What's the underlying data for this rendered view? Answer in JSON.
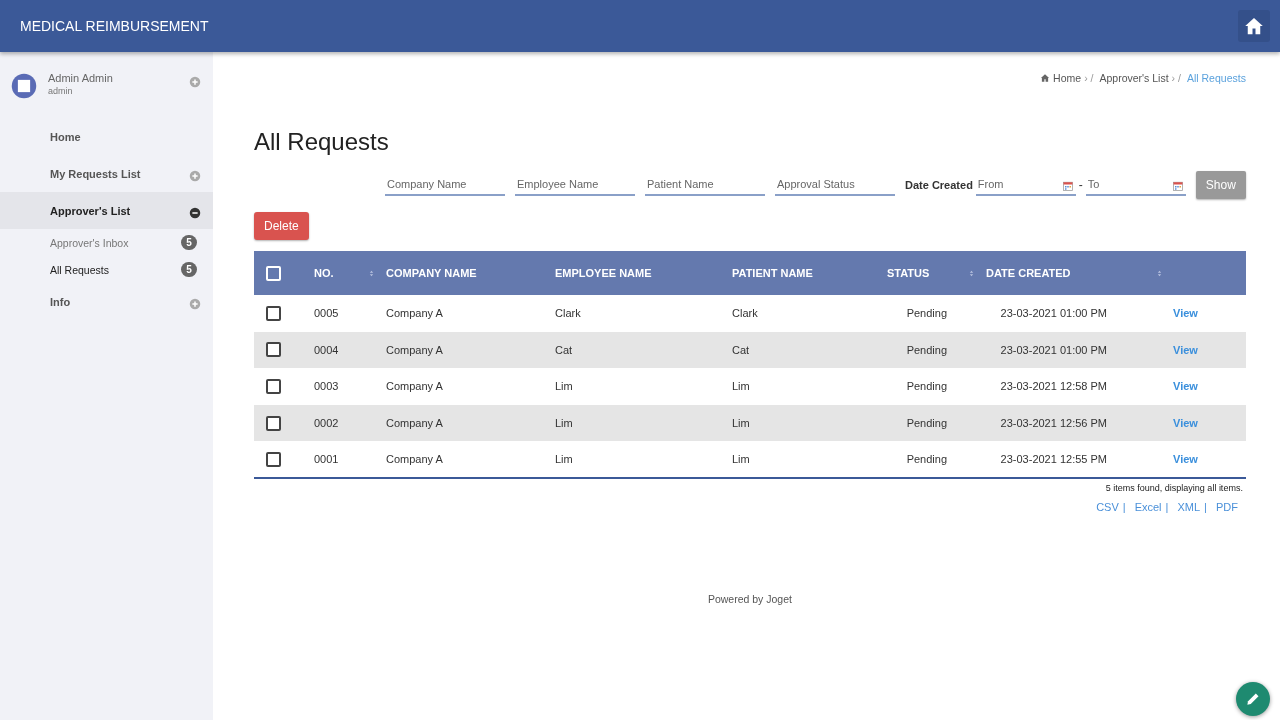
{
  "app_bar": {
    "title": "MEDICAL REIMBURSEMENT"
  },
  "sidebar": {
    "user": {
      "name": "Admin Admin",
      "username": "admin"
    },
    "items": [
      {
        "label": "Home",
        "selected": false
      },
      {
        "label": "My Requests List",
        "selected": false,
        "expanded": false
      },
      {
        "label": "Approver's List",
        "selected": true,
        "expanded": true,
        "children": [
          {
            "label": "Approver's Inbox",
            "count": "5",
            "selected": false
          },
          {
            "label": "All Requests",
            "count": "5",
            "selected": true
          }
        ]
      },
      {
        "label": "Info",
        "selected": false,
        "expanded": false
      }
    ]
  },
  "breadcrumb": [
    {
      "label": "Home",
      "separator": "› /",
      "current": false
    },
    {
      "label": "Approver's List",
      "separator": "› /",
      "current": false
    },
    {
      "label": "All Requests",
      "current": true
    }
  ],
  "page_title": "All Requests",
  "filters": {
    "fields": [
      {
        "placeholder": "Company Name"
      },
      {
        "placeholder": "Employee Name"
      },
      {
        "placeholder": "Patient Name"
      },
      {
        "placeholder": "Approval Status"
      }
    ],
    "date_label": "Date Created",
    "from": {
      "placeholder": "From"
    },
    "dash": "-",
    "to": {
      "placeholder": "To"
    },
    "show_button": "Show"
  },
  "delete_button": "Delete",
  "table": {
    "header_checked": false,
    "columns": [
      {
        "label": "NO.",
        "sortable": true
      },
      {
        "label": "COMPANY NAME",
        "sortable": false
      },
      {
        "label": "EMPLOYEE NAME",
        "sortable": false
      },
      {
        "label": "PATIENT NAME",
        "sortable": false
      },
      {
        "label": "STATUS",
        "sortable": true
      },
      {
        "label": "DATE CREATED",
        "sortable": true
      }
    ],
    "rows": [
      {
        "checked": false,
        "cells": [
          "0005",
          "Company A",
          "Clark",
          "Clark",
          "Pending",
          "23-03-2021 01:00 PM"
        ],
        "action": "View"
      },
      {
        "checked": false,
        "cells": [
          "0004",
          "Company A",
          "Cat",
          "Cat",
          "Pending",
          "23-03-2021 01:00 PM"
        ],
        "action": "View"
      },
      {
        "checked": false,
        "cells": [
          "0003",
          "Company A",
          "Lim",
          "Lim",
          "Pending",
          "23-03-2021 12:58 PM"
        ],
        "action": "View"
      },
      {
        "checked": false,
        "cells": [
          "0002",
          "Company A",
          "Lim",
          "Lim",
          "Pending",
          "23-03-2021 12:56 PM"
        ],
        "action": "View"
      },
      {
        "checked": false,
        "cells": [
          "0001",
          "Company A",
          "Lim",
          "Lim",
          "Pending",
          "23-03-2021 12:55 PM"
        ],
        "action": "View"
      }
    ]
  },
  "summary": "5 items found, displaying all items.",
  "exports": [
    {
      "label": "CSV",
      "separator": "|"
    },
    {
      "label": "Excel",
      "separator": "|"
    },
    {
      "label": "XML",
      "separator": "|"
    },
    {
      "label": "PDF"
    }
  ],
  "footer": "Powered by Joget"
}
